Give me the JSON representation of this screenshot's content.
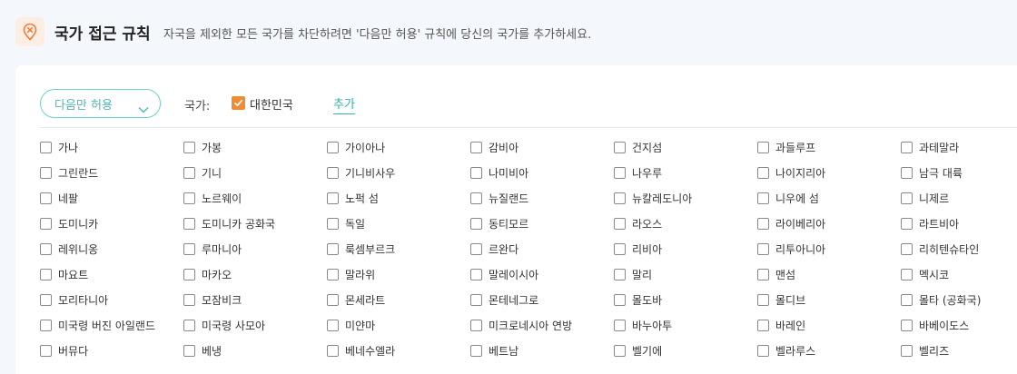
{
  "header": {
    "title": "국가 접근 규칙",
    "description": "자국을 제외한 모든 국가를 차단하려면 '다음만 허용' 규칙에 당신의 국가를 추가하세요.",
    "icon": "location-block-icon",
    "accent_color": "#f07c3a"
  },
  "controls": {
    "mode_value": "다음만 허용",
    "country_label": "국가:",
    "selected_country": "대한민국",
    "add_label": "추가",
    "accent_color": "#4bb8b4"
  },
  "countries": [
    "가나",
    "가봉",
    "가이아나",
    "감비아",
    "건지섬",
    "과들루프",
    "과테말라",
    "그린란드",
    "기니",
    "기니비사우",
    "나미비아",
    "나우루",
    "나이지리아",
    "남극 대륙",
    "네팔",
    "노르웨이",
    "노퍽 섬",
    "뉴질랜드",
    "뉴칼레도니아",
    "니우에 섬",
    "니제르",
    "도미니카",
    "도미니카 공화국",
    "독일",
    "동티모르",
    "라오스",
    "라이베리아",
    "라트비아",
    "레위니옹",
    "루마니아",
    "룩셈부르크",
    "르완다",
    "리비아",
    "리투아니아",
    "리히텐슈타인",
    "마요트",
    "마카오",
    "말라위",
    "말레이시아",
    "말리",
    "맨섬",
    "멕시코",
    "모리타니아",
    "모잠비크",
    "몬세라트",
    "몬테네그로",
    "몰도바",
    "몰디브",
    "몰타 (공화국)",
    "미국령 버진 아일랜드",
    "미국령 사모아",
    "미얀마",
    "미크로네시아 연방",
    "바누아투",
    "바레인",
    "바베이도스",
    "버뮤다",
    "베냉",
    "베네수엘라",
    "베트남",
    "벨기에",
    "벨라루스",
    "벨리즈"
  ]
}
